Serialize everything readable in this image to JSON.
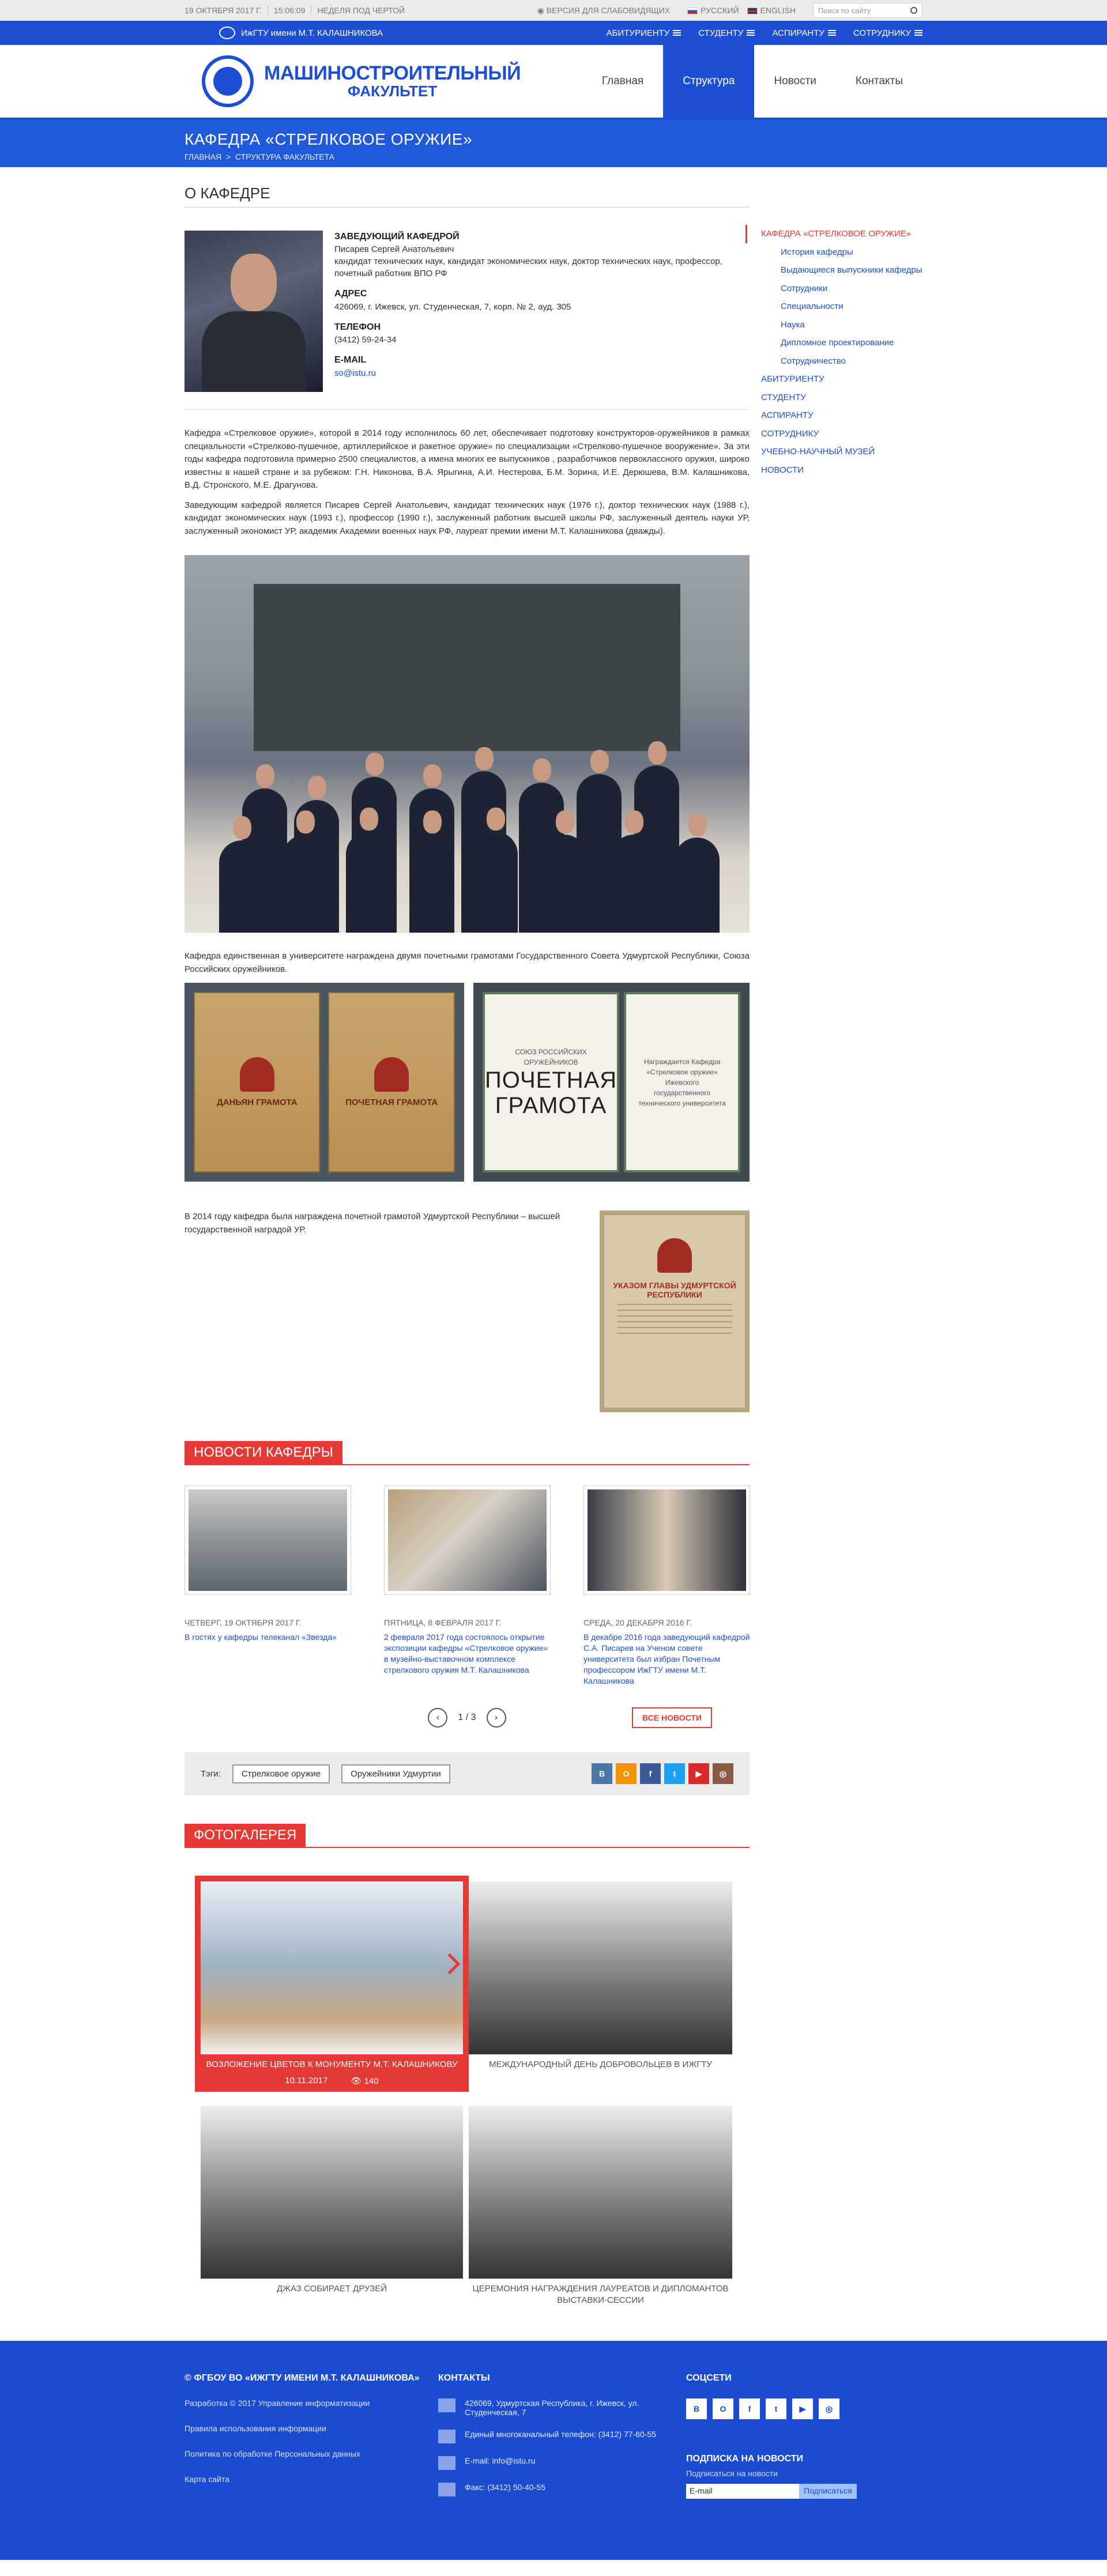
{
  "topbar": {
    "date": "19 ОКТЯБРЯ 2017 Г.",
    "time": "15:06:09",
    "week": "НЕДЕЛЯ ПОД ЧЕРТОЙ",
    "access": "ВЕРСИЯ ДЛЯ СЛАБОВИДЯЩИХ",
    "lang_ru": "РУССКИЙ",
    "lang_en": "ENGLISH",
    "search_placeholder": "Поиск по сайту"
  },
  "navbar": {
    "uni": "ИжГТУ имени М.Т. КАЛАШНИКОВА",
    "menu": [
      "АБИТУРИЕНТУ",
      "СТУДЕНТУ",
      "АСПИРАНТУ",
      "СОТРУДНИКУ"
    ]
  },
  "header": {
    "logo_line1": "МАШИНОСТРОИТЕЛЬНЫЙ",
    "logo_line2": "ФАКУЛЬТЕТ",
    "menu": [
      "Главная",
      "Структура",
      "Новости",
      "Контакты"
    ]
  },
  "banner": {
    "title": "КАФЕДРА «СТРЕЛКОВОЕ ОРУЖИЕ»",
    "crumb1": "ГЛАВНАЯ",
    "crumb2": "СТРУКТУРА ФАКУЛЬТЕТА"
  },
  "about": {
    "title": "О КАФЕДРЕ",
    "head_label": "ЗАВЕДУЮЩИЙ КАФЕДРОЙ",
    "head_name": "Писарев Сергей Анатольевич",
    "head_desc": "кандидат технических наук, кандидат экономических наук, доктор технических наук, профессор, почетный работник ВПО РФ",
    "address_label": "АДРЕС",
    "address": "426069, г. Ижевск, ул. Студенческая, 7, корп. № 2, ауд. 305",
    "phone_label": "ТЕЛЕФОН",
    "phone": "(3412) 59-24-34",
    "email_label": "E-MAIL",
    "email": "so@istu.ru",
    "p1": "Кафедра «Стрелковое оружие», которой в 2014 году исполнилось 60 лет, обеспечивает подготовку конструкторов-оружейников в рамках специальности «Стрелково-пушечное, артиллерийское и ракетное оружие» по специализации «Стрелково-пушечное вооружение». За эти годы кафедра подготовила примерно 2500 специалистов, а имена многих ее выпускников , разработчиков первоклассного оружия, широко известны в нашей стране и за рубежом: Г.Н. Никонова, В.А. Ярыгина, А.И. Нестерова, Б.М. Зорина, И.Е. Дерюшева, В.М. Калашникова, В.Д. Стронского, М.Е. Драгунова.",
    "p2": "Заведующим кафедрой является Писарев Сергей Анатольевич, кандидат технических наук (1976 г.), доктор технических наук (1988 г.), кандидат экономических наук (1993 г.), профессор (1990 г.), заслуженный работник высшей школы РФ, заслуженный деятель науки УР, заслуженный экономист УР, академик Академии военных наук РФ, лауреат премии имени М.Т. Калашникова (дважды).",
    "p3": "Кафедра единственная в университете награждена двумя почетными грамотами Государственного Совета Удмуртской Республики, Союза Российских оружейников.",
    "p4": "В 2014 году кафедра была награждена почетной грамотой Удмуртской Республики – высшей государственной наградой УР.",
    "award1a": "ДАНЬЯН ГРАМОТА",
    "award1b": "ПОЧЕТНАЯ ГРАМОТА",
    "award2_org": "СОЮЗ РОССИЙСКИХ ОРУЖЕЙНИКОВ",
    "award2_big1": "ПОЧЕТНАЯ",
    "award2_big2": "ГРАМОТА",
    "award2_right": "Награждается Кафедра «Стрелковое оружие» Ижевского государственного технического университета",
    "award3": "УКАЗОМ ГЛАВЫ УДМУРТСКОЙ РЕСПУБЛИКИ"
  },
  "news": {
    "title": "НОВОСТИ КАФЕДРЫ",
    "items": [
      {
        "date": "ЧЕТВЕРГ, 19 ОКТЯБРЯ 2017 Г.",
        "title": "В гостях у кафедры телеканал «Звезда»"
      },
      {
        "date": "ПЯТНИЦА, 8 ФЕВРАЛЯ 2017 Г.",
        "title": "2 февраля 2017 года состоялось открытие экспозиции кафедры «Стрелковое оружие» в музейно-выставочном комплексе стрелкового оружия М.Т. Калашникова"
      },
      {
        "date": "СРЕДА, 20 ДЕКАБРЯ 2016 Г.",
        "title": "В декабре 2016 года заведующий кафедрой С.А. Писарев на Ученом совете университета был избран Почетным профессором ИжГТУ имени М.Т. Калашникова"
      }
    ],
    "page": "1 / 3",
    "all": "ВСЕ НОВОСТИ"
  },
  "tags": {
    "label": "Тэги:",
    "items": [
      "Стрелковое оружие",
      "Оружейники Удмуртии"
    ]
  },
  "gallery": {
    "title": "ФОТОГАЛЕРЕЯ",
    "items": [
      {
        "caption": "ВОЗЛОЖЕНИЕ ЦВЕТОВ К МОНУМЕНТУ М.Т. КАЛАШНИКОВУ",
        "date": "10.11.2017",
        "views": "140"
      },
      {
        "caption": "МЕЖДУНАРОДНЫЙ ДЕНЬ ДОБРОВОЛЬЦЕВ В ИЖГТУ"
      },
      {
        "caption": "ДЖАЗ СОБИРАЕТ ДРУЗЕЙ"
      },
      {
        "caption": "ЦЕРЕМОНИЯ НАГРАЖДЕНИЯ ЛАУРЕАТОВ И ДИПЛОМАНТОВ ВЫСТАВКИ-СЕССИИ"
      }
    ]
  },
  "aside": {
    "current": "КАФЕДРА «СТРЕЛКОВОЕ ОРУЖИЕ»",
    "sub": [
      "История кафедры",
      "Выдающиеся выпускники кафедры",
      "Сотрудники",
      "Специальности",
      "Наука",
      "Дипломное проектирование",
      "Сотрудничество"
    ],
    "links": [
      "АБИТУРИЕНТУ",
      "СТУДЕНТУ",
      "АСПИРАНТУ",
      "СОТРУДНИКУ",
      "УЧЕБНО-НАУЧНЫЙ МУЗЕЙ",
      "НОВОСТИ"
    ]
  },
  "footer": {
    "org": "© ФГБОУ ВО «ИжГТУ имени М.Т. КАЛАШНИКОВА»",
    "links": [
      "Разработка © 2017 Управление информатизации",
      "Правила использования информации",
      "Политика по обработке Персональных данных",
      "Карта сайта"
    ],
    "contacts_title": "КОНТАКТЫ",
    "address": "426069, Удмуртская Республика, г. Ижевск, ул. Студенческая, 7",
    "phone": "Единый многоканальный телефон: (3412) 77-60-55",
    "email": "E-mail: info@istu.ru",
    "fax": "Факс: (3412) 50-40-55",
    "social_title": "СОЦСЕТИ",
    "subscribe_title": "ПОДПИСКА НА НОВОСТИ",
    "subscribe_hint": "Подписаться на новости",
    "email_placeholder": "E-mail",
    "subscribe_btn": "Подписаться"
  },
  "colors": {
    "brand_blue": "#1d4fd4",
    "accent_red": "#e53935"
  }
}
